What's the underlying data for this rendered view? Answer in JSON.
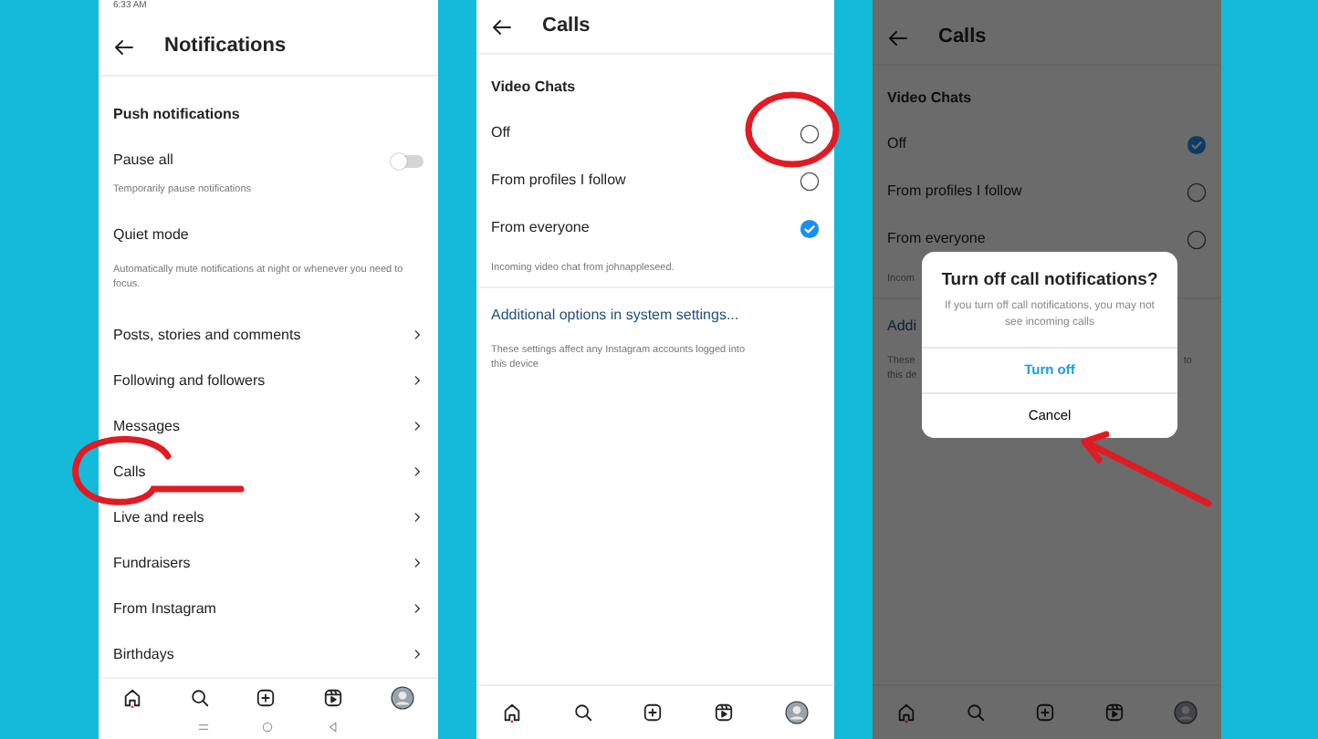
{
  "notifications_screen": {
    "status_time": "6:33 AM",
    "title": "Notifications",
    "section_title": "Push notifications",
    "pause_all": {
      "label": "Pause all",
      "on": false,
      "hint": "Temporarily pause notifications"
    },
    "quiet_mode": {
      "label": "Quiet mode",
      "hint": "Automatically mute notifications at night or whenever you need to focus."
    },
    "items": [
      {
        "label": "Posts, stories and comments"
      },
      {
        "label": "Following and followers"
      },
      {
        "label": "Messages"
      },
      {
        "label": "Calls"
      },
      {
        "label": "Live and reels"
      },
      {
        "label": "Fundraisers"
      },
      {
        "label": "From Instagram"
      },
      {
        "label": "Birthdays"
      }
    ]
  },
  "calls_screen": {
    "title": "Calls",
    "section_title": "Video Chats",
    "options": [
      {
        "label": "Off",
        "selected": false
      },
      {
        "label": "From profiles I follow",
        "selected": false
      },
      {
        "label": "From everyone",
        "selected": true
      }
    ],
    "hint": "Incoming video chat from johnappleseed.",
    "link": "Additional options in system settings...",
    "footer_lines": [
      [
        "These settings affect any Instagram accounts logged into"
      ],
      [
        "this device"
      ]
    ]
  },
  "confirm_screen": {
    "title": "Calls",
    "section_title": "Video Chats",
    "options": [
      {
        "label": "Off",
        "selected": true
      },
      {
        "label": "From profiles I follow",
        "selected": false
      },
      {
        "label": "From everyone",
        "selected": false
      }
    ],
    "hint": "Incom",
    "link": "Addi",
    "footer_lines": [
      [
        "These",
        "to"
      ],
      [
        "this de"
      ]
    ],
    "dialog": {
      "title": "Turn off call notifications?",
      "message": "If you turn off call notifications, you may not see incoming calls",
      "buttons": [
        {
          "label": "Turn off",
          "kind": "primary"
        },
        {
          "label": "Cancel",
          "kind": "secondary"
        }
      ]
    }
  }
}
